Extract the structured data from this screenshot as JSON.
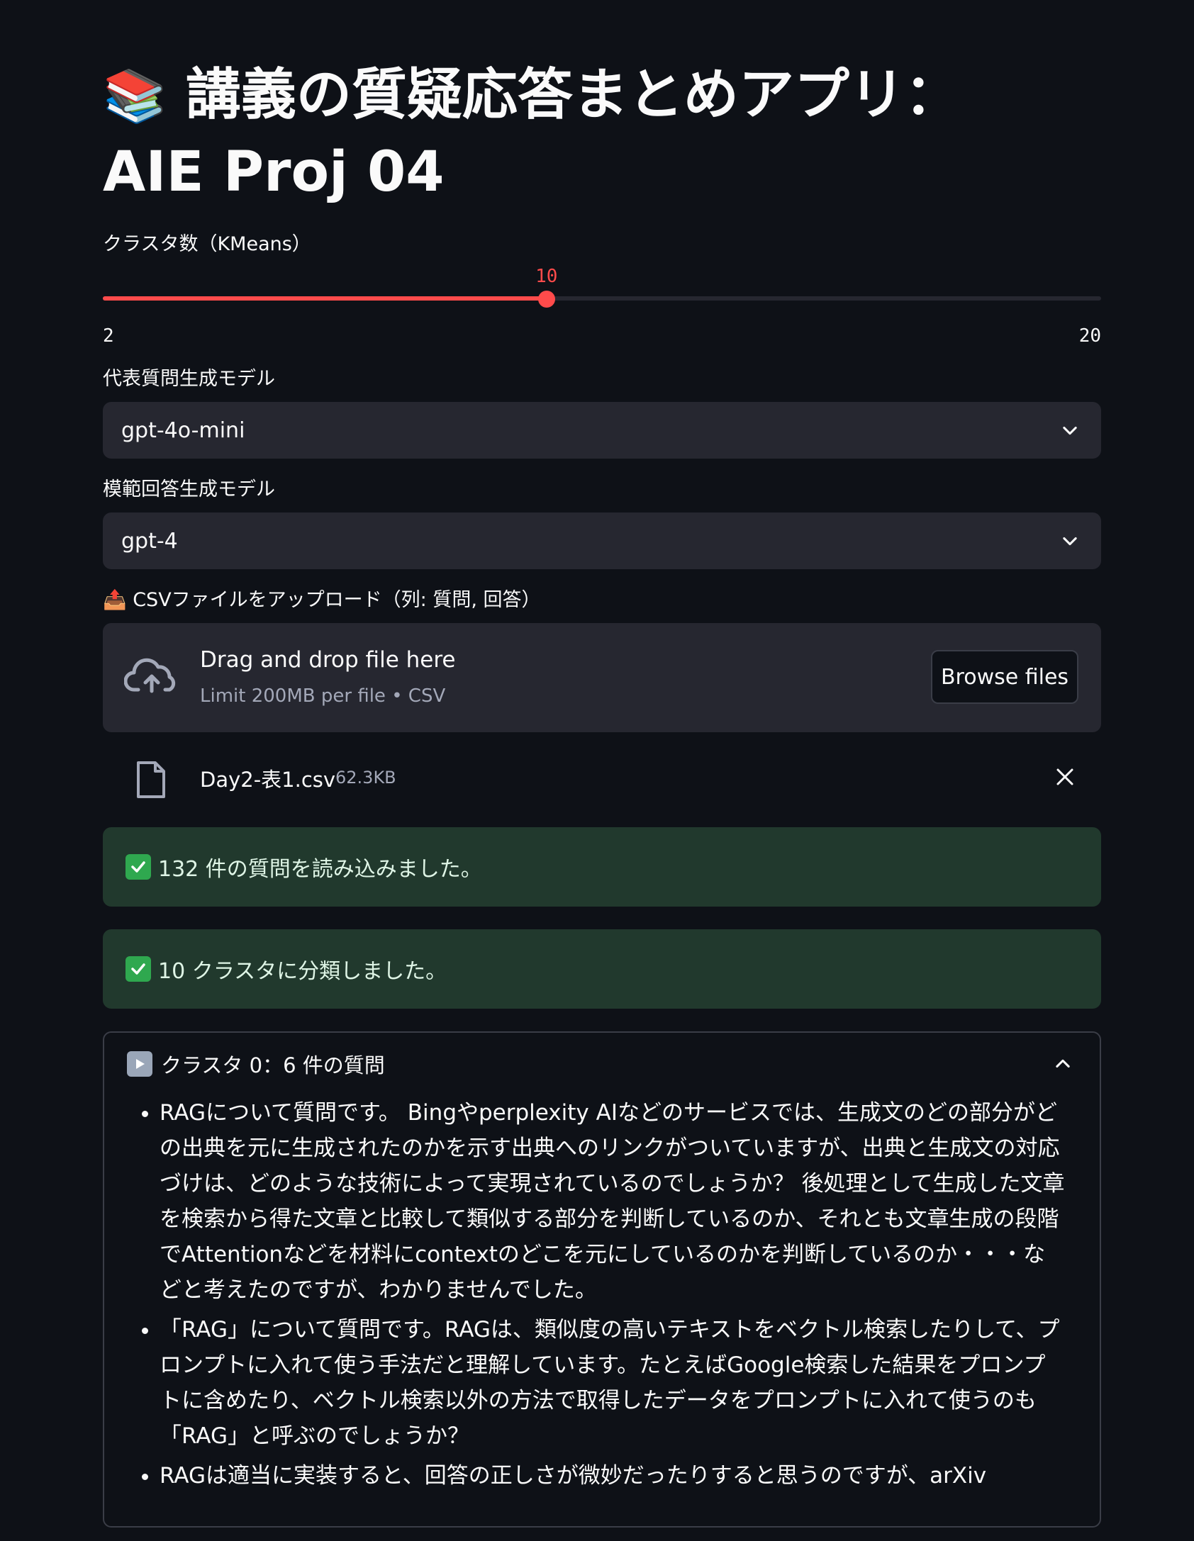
{
  "title": {
    "icon": "books-icon",
    "line1": "講義の質疑応答まとめアプリ：",
    "line2": "AIE Proj 04"
  },
  "slider": {
    "label": "クラスタ数（KMeans）",
    "value": 10,
    "value_text": "10",
    "min": 2,
    "max": 20,
    "min_text": "2",
    "max_text": "20",
    "accent": "#ff4b4b"
  },
  "question_model": {
    "label": "代表質問生成モデル",
    "value": "gpt-4o-mini"
  },
  "answer_model": {
    "label": "模範回答生成モデル",
    "value": "gpt-4"
  },
  "upload": {
    "label": "📤 CSVファイルをアップロード（列: 質問, 回答）",
    "drop_text": "Drag and drop file here",
    "limit_text": "Limit 200MB per file • CSV",
    "browse_label": "Browse files",
    "file_name": "Day2-表1.csv",
    "file_size": "62.3KB"
  },
  "alerts": [
    {
      "text": "132 件の質問を読み込みました。",
      "color": "#21392d"
    },
    {
      "text": "10 クラスタに分類しました。",
      "color": "#21392d"
    }
  ],
  "expander": {
    "header": "クラスタ 0：6 件の質問",
    "items": [
      "RAGについて質問です。 Bingやperplexity AIなどのサービスでは、生成文のどの部分がどの出典を元に生成されたのかを示す出典へのリンクがついていますが、出典と生成文の対応づけは、どのような技術によって実現されているのでしょうか？ 後処理として生成した文章を検索から得た文章と比較して類似する部分を判断しているのか、それとも文章生成の段階でAttentionなどを材料にcontextのどこを元にしているのかを判断しているのか・・・などと考えたのですが、わかりませんでした。",
      "「RAG」について質問です。RAGは、類似度の高いテキストをベクトル検索したりして、プロンプトに入れて使う手法だと理解しています。たとえばGoogle検索した結果をプロンプトに含めたり、ベクトル検索以外の方法で取得したデータをプロンプトに入れて使うのも「RAG」と呼ぶのでしょうか？",
      "RAGは適当に実装すると、回答の正しさが微妙だったりすると思うのですが、arXiv"
    ]
  }
}
